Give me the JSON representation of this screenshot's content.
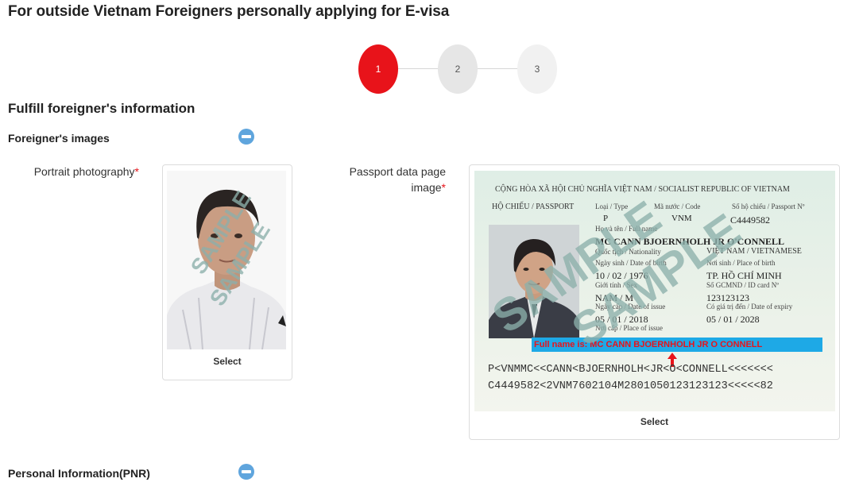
{
  "page": {
    "title": "For outside Vietnam Foreigners personally applying for E-visa"
  },
  "stepper": {
    "steps": [
      "1",
      "2",
      "3"
    ],
    "active_step": 1
  },
  "section": {
    "title": "Fulfill foreigner's information"
  },
  "images_group": {
    "title": "Foreigner's images",
    "portrait": {
      "label": "Portrait photography",
      "required_mark": "*",
      "select_label": "Select",
      "watermark": "SAMPLE"
    },
    "passport": {
      "label_line1": "Passport data page",
      "label_line2": "image",
      "required_mark": "*",
      "select_label": "Select",
      "watermark": "SAMPLE",
      "doc": {
        "header": "CỘNG HÒA XÃ HỘI CHỦ NGHĨA VIỆT NAM / SOCIALIST REPUBLIC OF VIETNAM",
        "doc_label": "HỘ CHIẾU / PASSPORT",
        "type_label": "Loại / Type",
        "code_label": "Mã nước / Code",
        "number_label": "Số hộ chiếu / Passport Nº",
        "type_value": "P",
        "code_value": "VNM",
        "number_value": "C4449582",
        "name_label": "Họ và tên / Full name",
        "name_value": "MC CANN BJOERNHOLH JR O'CONNELL",
        "nationality_label": "Quốc tịch / Nationality",
        "nationality_value": "VIỆT NAM / VIETNAMESE",
        "dob_label": "Ngày sinh / Date of birth",
        "dob_value": "10 / 02 / 1976",
        "pob_label": "Nơi sinh / Place of birth",
        "pob_value": "TP. HỒ CHÍ MINH",
        "sex_label": "Giới tính / Sex",
        "sex_value": "NAM / M",
        "id_label": "Số GCMND / ID card Nº",
        "id_value": "123123123",
        "issue_label": "Ngày cấp / Date of issue",
        "issue_value": "05 / 01 / 2018",
        "expiry_label": "Có giá trị đến / Date of expiry",
        "expiry_value": "05 / 01 / 2028",
        "place_issue_label": "Nơi cấp / Place of issue",
        "fullname_banner": "Full name is: MC CANN BJOERNHOLH JR O CONNELL",
        "mrz1": "P<VNMMC<<CANN<BJOERNHOLH<JR<O<CONNELL<<<<<<<",
        "mrz2": "C4449582<2VNM7602104M2801050123123123<<<<<82"
      }
    }
  },
  "pnr_group": {
    "title": "Personal Information(PNR)"
  },
  "colors": {
    "accent_red": "#e8131a",
    "collapse_blue": "#5fa5dd",
    "banner_blue": "#1ea9e6"
  },
  "icons": {
    "collapse": "minus-circle-icon",
    "arrow": "arrow-up-icon"
  }
}
